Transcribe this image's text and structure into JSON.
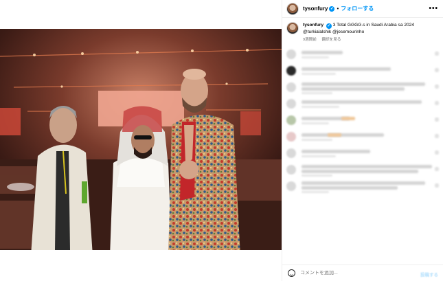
{
  "header": {
    "username": "tysonfury",
    "separator": "•",
    "follow_label": "フォローする",
    "more_label": "•••"
  },
  "caption": {
    "username": "tysonfury",
    "text": "3 Total GGGG.s in Saudi Arabia sa 2024",
    "mentions": "@turkialalshik @josemourinho",
    "time_ago": "9週間前",
    "translate_label": "翻訳を見る"
  },
  "comment_box": {
    "placeholder": "コメントを追加..."
  },
  "colors": {
    "accent": "#0095f6",
    "muted_text": "#737373",
    "border": "#efefef",
    "photo_background": "#2a1512"
  },
  "icons": {
    "verified": "verified-badge-icon",
    "more": "more-options-icon",
    "emoji": "emoji-icon"
  }
}
